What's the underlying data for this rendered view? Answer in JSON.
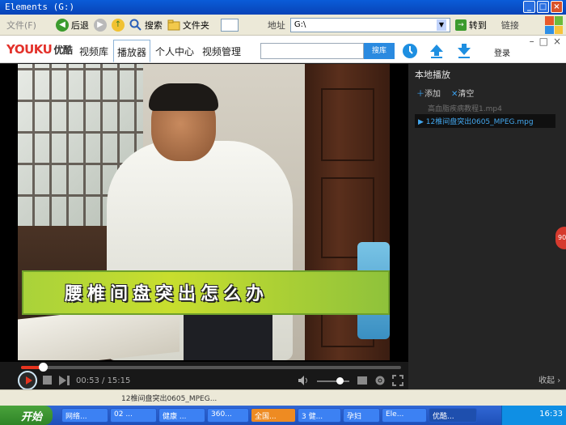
{
  "explorer": {
    "title": "Elements (G:)",
    "menu_file": "文件(F)",
    "back_label": "后退",
    "search_label": "搜索",
    "folders_label": "文件夹",
    "address_label": "地址",
    "address_value": "G:\\",
    "go_label": "转到",
    "links_label": "链接"
  },
  "youku": {
    "logo_youku": "YOUKU",
    "logo_cn": "优酷",
    "nav": [
      "视频库",
      "播放器",
      "个人中心",
      "视频管理"
    ],
    "active_tab": "播放器",
    "search_placeholder": "",
    "search_button": "搜库",
    "login_label": "登录"
  },
  "video": {
    "subtitle": "腰椎间盘突出怎么办",
    "current_time": "00:53",
    "total_time": "15:15",
    "progress_fraction": 0.058,
    "volume_fraction": 0.7
  },
  "playlist": {
    "title": "本地播放",
    "add_label": "添加",
    "clear_label": "清空",
    "items": [
      {
        "name": "高血脂疾病教程1.mp4",
        "playing": false
      },
      {
        "name": "12椎间盘突出0605_MPEG.mpg",
        "playing": true
      }
    ],
    "collapse_label": "收起",
    "side_badge": "90"
  },
  "taskbar": {
    "start_label": "开始",
    "tasks": [
      "网络...",
      "02 ...",
      "健康 ...",
      "360...",
      "全国...",
      "3 健...",
      "孕妇",
      "Ele...",
      "优酷..."
    ],
    "active_task_index": 4,
    "selected_task_index": 8,
    "clock": "16:33",
    "bg_file": "12椎间盘突出0605_MPEG..."
  },
  "colors": {
    "youku_red": "#e3322b",
    "youku_blue": "#1e8fe1",
    "accent_blue": "#43a7ee",
    "progress_red": "#e5341f"
  }
}
